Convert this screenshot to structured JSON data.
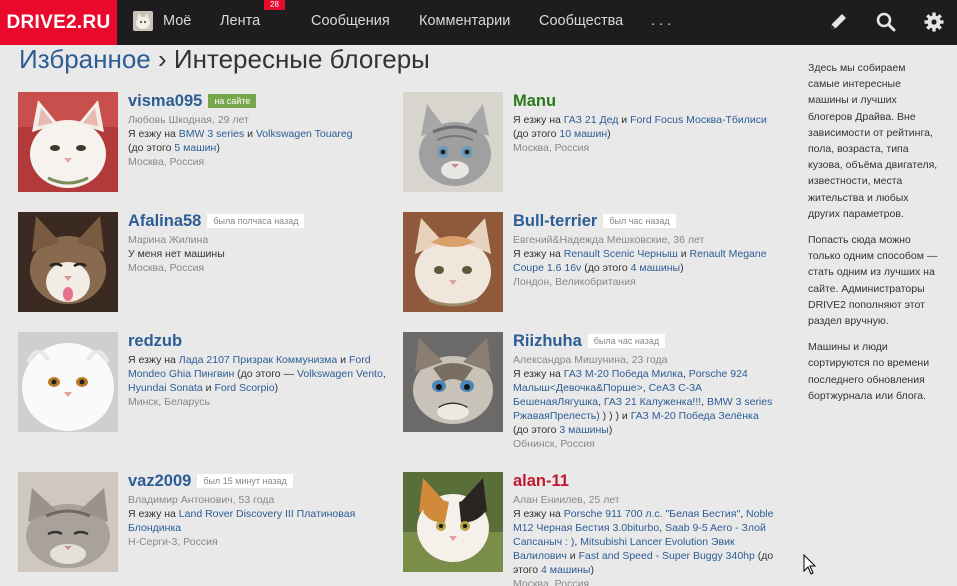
{
  "nav": {
    "logo": "DRIVE2.RU",
    "me": "Моё",
    "feed": "Лента",
    "feed_badge": "28",
    "messages": "Сообщения",
    "comments": "Комментарии",
    "communities": "Сообщества",
    "more": ". . .",
    "icons": [
      "pencil-icon",
      "search-icon",
      "gear-icon"
    ]
  },
  "breadcrumb": {
    "parent": "Избранное",
    "sep": "›",
    "current": "Интересные блогеры"
  },
  "bloggers": [
    {
      "username": "visma095",
      "status": "на сайте",
      "realname": "Любовь Шкодная, 29 лет",
      "drive_prefix": "Я езжу на",
      "car1": "BMW 3 series",
      "conj": "и",
      "car2": "Volkswagen Touareg",
      "before_prefix": "(до этого",
      "before_count": "5 машин",
      "before_suffix": ")",
      "location": "Москва, Россия"
    },
    {
      "username": "Manu",
      "drive_prefix": "Я езжу на",
      "car1": "ГАЗ 21 Дед",
      "conj": "и",
      "car2": "Ford Focus Москва-Тбилиси",
      "before_prefix": "(до этого",
      "before_count": "10 машин",
      "before_suffix": ")",
      "location": "Москва, Россия"
    },
    {
      "username": "Afalina58",
      "status": "была полчаса назад",
      "realname": "Марина Жилина",
      "nocar": "У меня нет машины",
      "location": "Москва, Россия"
    },
    {
      "username": "Bull-terrier",
      "status": "был час назад",
      "realname": "Евгений&Надежда Мешковские, 36 лет",
      "drive_prefix": "Я езжу на",
      "car1": "Renault Scenic Черныш",
      "conj": "и",
      "car2": "Renault Megane Coupe 1.6 16v",
      "before_prefix": "(до этого",
      "before_count": "4 машины",
      "before_suffix": ")",
      "location": "Лондон, Великобритания"
    },
    {
      "username": "redzub",
      "drive_prefix": "Я езжу на",
      "car1": "Лада 2107 Призрак Коммунизма",
      "conj": "и",
      "car2": "Ford Mondeo Ghia Пингвин",
      "before_prefix": "(до этого —",
      "car3": "Volkswagen Vento",
      "car4": "Hyundai Sonata",
      "conj2": "и",
      "car5": "Ford Scorpio",
      "before_suffix": ")",
      "location": "Минск, Беларусь"
    },
    {
      "username": "Riizhuha",
      "status": "была час назад",
      "realname": "Александра Мишунина, 23 года",
      "drive_prefix": "Я езжу на",
      "car1": "ГАЗ М-20 Победа Милка",
      "car2": "Porsche 924 Малыш<Девочка&Порше>",
      "car3": "СеАЗ С-3А БешенаяЛягушка",
      "car4": "ГАЗ 21 Калуженка!!!",
      "car5": "BMW 3 series РжаваяПрелесть)",
      "mid": ") ) ) и",
      "car6": "ГАЗ М-20 Победа Зелёнка",
      "before_prefix": "(до этого",
      "before_count": "3 машины",
      "before_suffix": ")",
      "location": "Обнинск, Россия"
    },
    {
      "username": "vaz2009",
      "status": "был 15 минут назад",
      "realname": "Владимир Антонович, 53 года",
      "drive_prefix": "Я езжу на",
      "car1": "Land Rover Discovery III Платиновая Блондинка",
      "location": "Н-Серги-3, Россия"
    },
    {
      "username": "alan-11",
      "realname": "Алан Ениилев, 25 лет",
      "drive_prefix": "Я езжу на",
      "car1": "Porsche 911 700 л.с. \"Белая Бестия\"",
      "car2": "Noble M12 Черная Бестия 3.0biturbo",
      "car3": "Saab 9-5 Aero - Злой Сапсаныч : )",
      "car4": "Mitsubishi Lancer Evolution Эвик Валилович",
      "conj": "и",
      "car5": "Fast and Speed - Super Buggy 340hp",
      "before_prefix": "(до этого",
      "before_count": "4 машины",
      "before_suffix": ")",
      "location": "Москва, Россия"
    }
  ],
  "sidebar": {
    "p1": "Здесь мы собираем самые интересные машины и лучших блогеров Драйва. Вне зависимости от рейтинга, пола, возраста, типа кузова, объёма двигателя, известности, места жительства и любых других параметров.",
    "p2": "Попасть сюда можно только одним способом — стать одним из лучших на сайте. Администраторы DRIVE2 пополняют этот раздел вручную.",
    "p3": "Машины и люди сортируются по времени последнего обновления бортжурнала или блога."
  }
}
